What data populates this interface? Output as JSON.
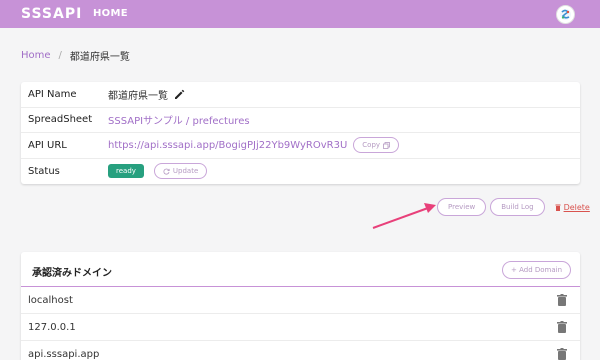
{
  "nav": {
    "logo": "SSSAPI",
    "home_label": "HOME"
  },
  "breadcrumb": {
    "home": "Home",
    "separator": "/",
    "current": "都道府県一覧"
  },
  "details": {
    "api_name_label": "API Name",
    "api_name_value": "都道府県一覧",
    "spreadsheet_label": "SpreadSheet",
    "spreadsheet_value": "SSSAPIサンプル / prefectures",
    "api_url_label": "API URL",
    "api_url_value": "https://api.sssapi.app/BogigPJj22Yb9WyROvR3U",
    "copy_label": "Copy",
    "status_label": "Status",
    "status_value": "ready",
    "update_label": "Update"
  },
  "actions": {
    "preview_label": "Preview",
    "build_log_label": "Build Log",
    "delete_label": "Delete"
  },
  "domains": {
    "title": "承認済みドメイン",
    "add_label": "+ Add Domain",
    "items": [
      "localhost",
      "127.0.0.1",
      "api.sssapi.app"
    ]
  },
  "colors": {
    "nav": "#c792d7",
    "accent": "#a16fc7",
    "ready": "#27a07f",
    "delete": "#d9534f",
    "arrow": "#e8407a"
  },
  "icons": [
    "pencil-icon",
    "copy-icon",
    "refresh-icon",
    "trash-icon",
    "avatar-icon",
    "arrow-annotation"
  ]
}
